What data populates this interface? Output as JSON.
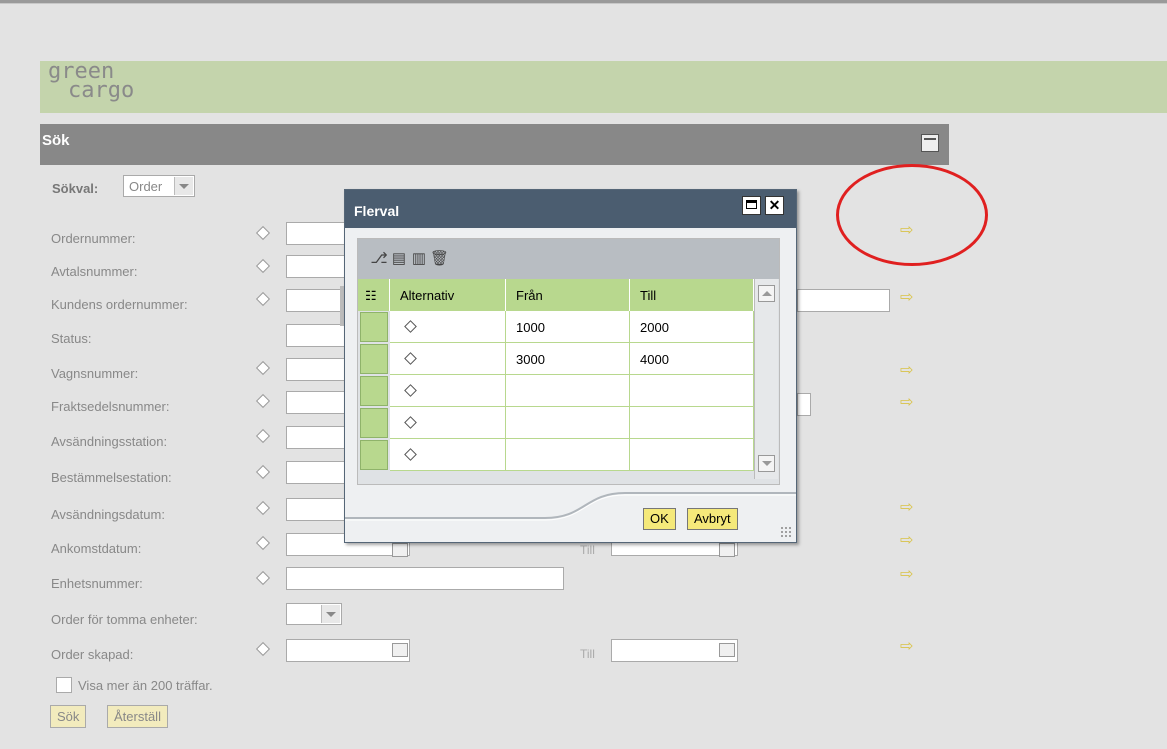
{
  "logo": {
    "line1": "green",
    "line2": "cargo"
  },
  "panel": {
    "title": "Sök"
  },
  "sokval": {
    "label": "Sökval:",
    "value": "Order"
  },
  "fields": [
    {
      "label": "Ordernummer:"
    },
    {
      "label": "Avtalsnummer:"
    },
    {
      "label": "Kundens ordernummer:"
    },
    {
      "label": "Status:"
    },
    {
      "label": "Vagnsnummer:"
    },
    {
      "label": "Fraktsedelsnummer:"
    },
    {
      "label": "Avsändningsstation:"
    },
    {
      "label": "Bestämmelsestation:"
    },
    {
      "label": "Avsändningsdatum:"
    },
    {
      "label": "Ankomstdatum:"
    },
    {
      "label": "Enhetsnummer:"
    },
    {
      "label": "Order för tomma enheter:"
    },
    {
      "label": "Order skapad:"
    }
  ],
  "till_label": "Till",
  "checkbox": {
    "label": "Visa mer än 200 träffar."
  },
  "buttons": {
    "search": "Sök",
    "reset": "Återställ"
  },
  "dialog": {
    "title": "Flerval",
    "close": "✕",
    "columns": [
      "Alternativ",
      "Från",
      "Till"
    ],
    "rows": [
      {
        "from": "1000",
        "to": "2000"
      },
      {
        "from": "3000",
        "to": "4000"
      },
      {
        "from": "",
        "to": ""
      },
      {
        "from": "",
        "to": ""
      },
      {
        "from": "",
        "to": ""
      }
    ],
    "ok": "OK",
    "cancel": "Avbryt"
  },
  "icons": {
    "arrow": "⇨",
    "colheader": "☷",
    "tb_add": "⎇",
    "tb_insert": "▤",
    "tb_remove": "▥",
    "tb_delete": "🗑"
  },
  "colors": {
    "green": "#b8d88e",
    "title_bar": "#4b5d70",
    "header_gray": "#888888",
    "logo_band": "#c4d4ac",
    "annotation": "#e02020"
  }
}
